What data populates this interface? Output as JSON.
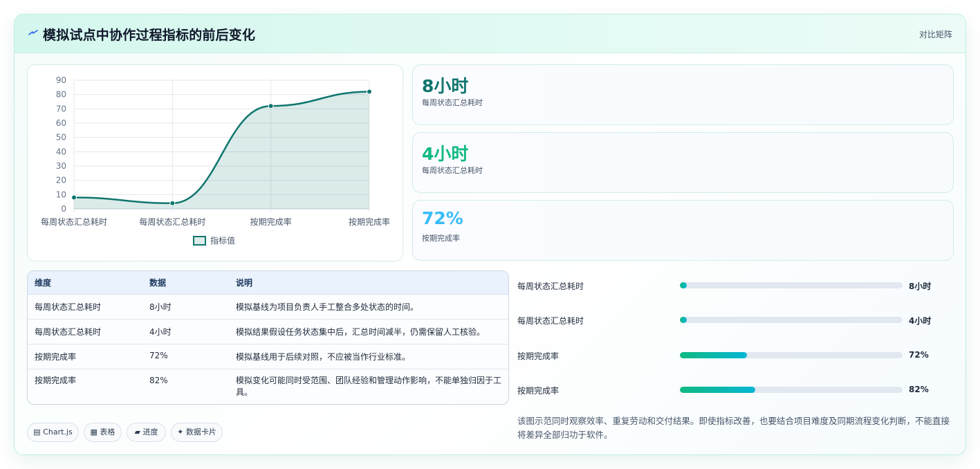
{
  "header": {
    "icon": "lightning-icon",
    "title": "模拟试点中协作过程指标的前后变化",
    "tag": "对比矩阵"
  },
  "chart_data": {
    "type": "line",
    "categories": [
      "每周状态汇总耗时",
      "每周状态汇总耗时",
      "按期完成率",
      "按期完成率"
    ],
    "series": [
      {
        "name": "指标值",
        "values": [
          8,
          4,
          72,
          82
        ],
        "color": "#0f766e",
        "fill": "rgba(15,118,110,0.15)"
      }
    ],
    "yticks": [
      0,
      10,
      20,
      30,
      40,
      50,
      60,
      70,
      80,
      90
    ],
    "ylim": [
      0,
      90
    ],
    "grid": true,
    "legend": "bottom",
    "smooth": true,
    "area": true
  },
  "kpis": [
    {
      "value": "8小时",
      "label": "每周状态汇总耗时",
      "color": "#0f766e"
    },
    {
      "value": "4小时",
      "label": "每周状态汇总耗时",
      "color": "#10b981"
    },
    {
      "value": "72%",
      "label": "按期完成率",
      "color": "#38bdf8"
    }
  ],
  "table": {
    "headers": [
      "维度",
      "数据",
      "说明"
    ],
    "rows": [
      [
        "每周状态汇总耗时",
        "8小时",
        "模拟基线为项目负责人手工整合多处状态的时间。"
      ],
      [
        "每周状态汇总耗时",
        "4小时",
        "模拟结果假设任务状态集中后，汇总时间减半，仍需保留人工核验。"
      ],
      [
        "按期完成率",
        "72%",
        "模拟基线用于后续对照，不应被当作行业标准。"
      ],
      [
        "按期完成率",
        "82%",
        "模拟变化可能同时受范围、团队经验和管理动作影响，不能单独归因于工具。"
      ]
    ]
  },
  "progress": [
    {
      "label": "每周状态汇总耗时",
      "value_text": "8小时",
      "fraction": 0.03
    },
    {
      "label": "每周状态汇总耗时",
      "value_text": "4小时",
      "fraction": 0.03
    },
    {
      "label": "按期完成率",
      "value_text": "72%",
      "fraction": 0.3
    },
    {
      "label": "按期完成率",
      "value_text": "82%",
      "fraction": 0.34
    }
  ],
  "chips": [
    "▤ Chart.js",
    "▦ 表格",
    "▰ 进度",
    "✦ 数据卡片"
  ],
  "note": "该图示范同时观察效率、重复劳动和交付结果。即使指标改善，也要结合项目难度及同期流程变化判断，不能直接将差异全部归功于软件。"
}
